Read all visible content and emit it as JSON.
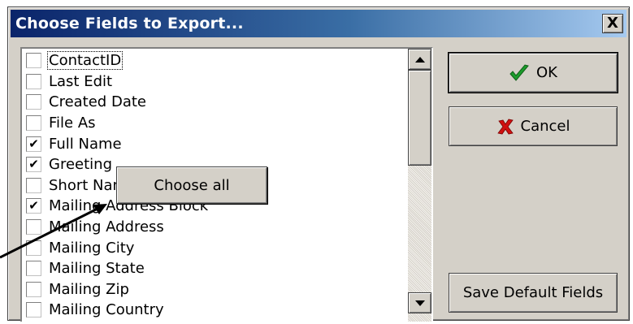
{
  "window": {
    "title": "Choose Fields to Export...",
    "close_label": "X"
  },
  "list": {
    "items": [
      {
        "label": "ContactID",
        "checked": false,
        "focused": true
      },
      {
        "label": "Last Edit",
        "checked": false
      },
      {
        "label": "Created Date",
        "checked": false
      },
      {
        "label": "File As",
        "checked": false
      },
      {
        "label": "Full Name",
        "checked": true
      },
      {
        "label": "Greeting",
        "checked": true
      },
      {
        "label": "Short Name",
        "checked": false
      },
      {
        "label": "Mailing Address Block",
        "checked": true
      },
      {
        "label": "Mailing Address",
        "checked": false
      },
      {
        "label": "Mailing City",
        "checked": false
      },
      {
        "label": "Mailing State",
        "checked": false
      },
      {
        "label": "Mailing Zip",
        "checked": false
      },
      {
        "label": "Mailing Country",
        "checked": false
      }
    ],
    "scroll_up_icon": "up-arrow",
    "scroll_down_icon": "down-arrow"
  },
  "buttons": {
    "ok_label": "OK",
    "cancel_label": "Cancel",
    "save_default_label": "Save Default Fields",
    "ok_icon": "checkmark-icon",
    "ok_icon_color": "#1c9c2c",
    "cancel_icon": "x-icon",
    "cancel_icon_color": "#d01010"
  },
  "context_menu": {
    "choose_all_label": "Choose all"
  },
  "checkbox_mark": "✔"
}
